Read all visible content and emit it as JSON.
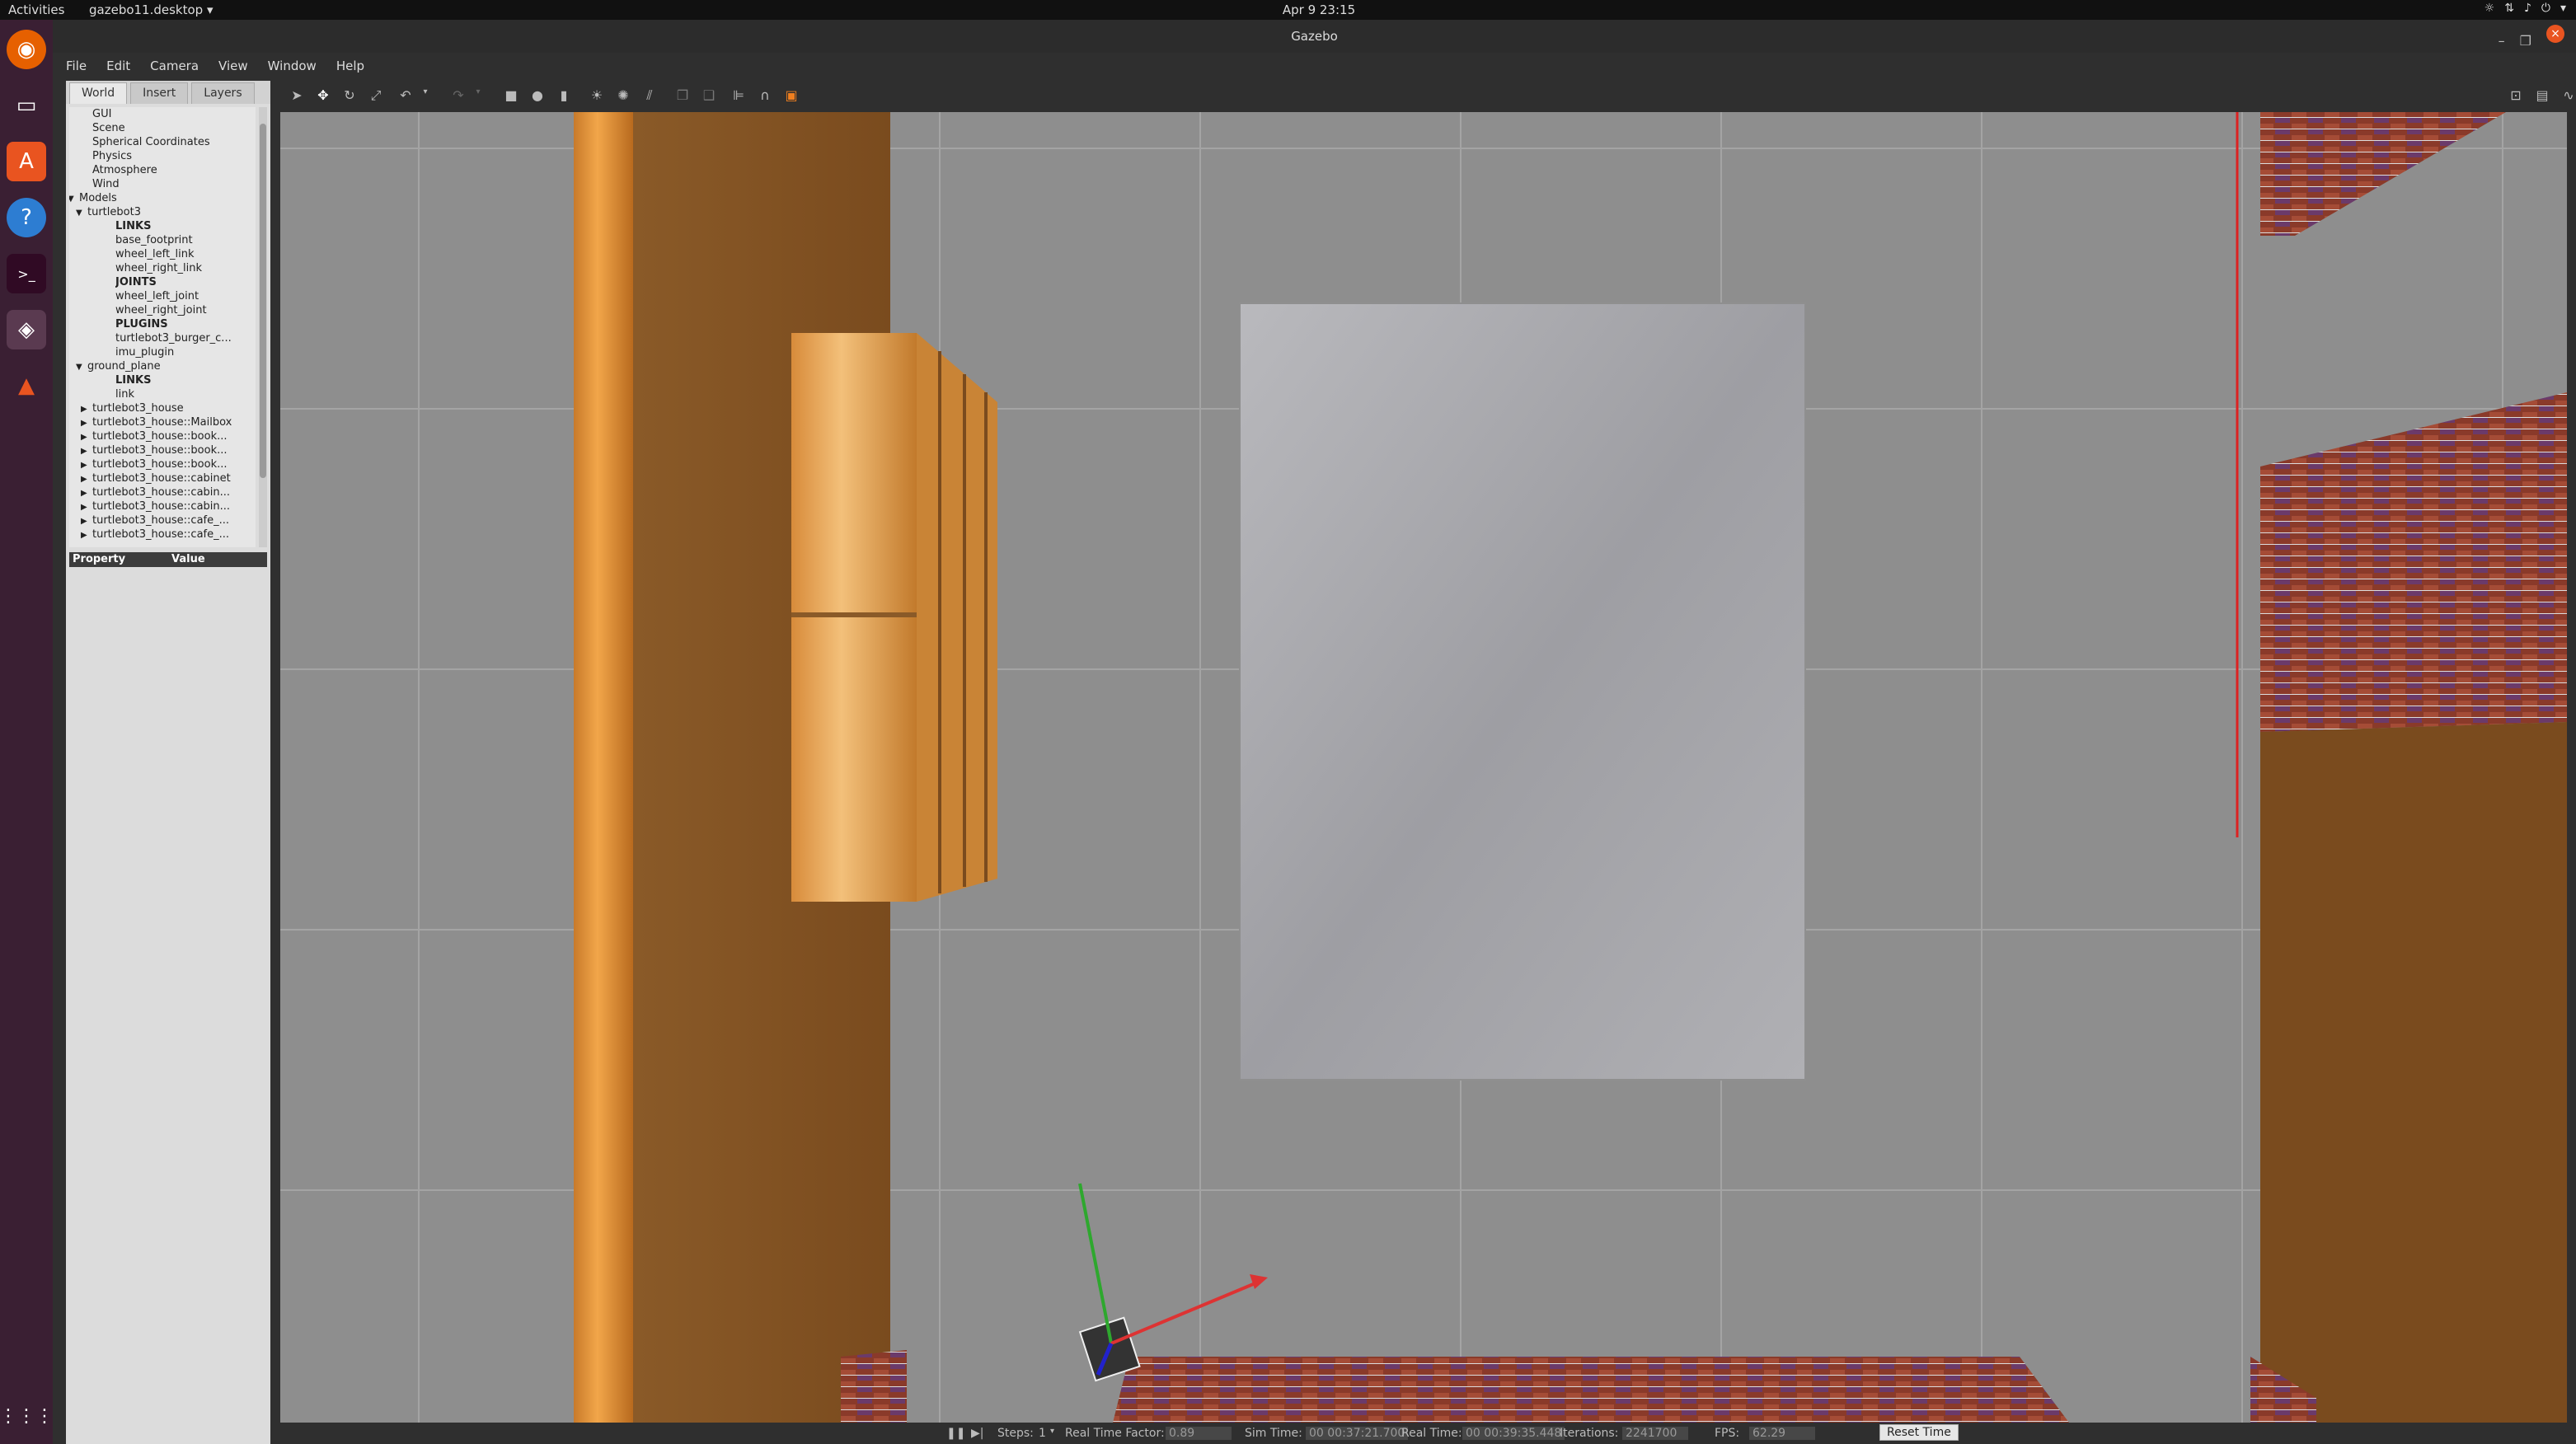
{
  "topbar": {
    "activities": "Activities",
    "app_menu": "gazebo11.desktop ▾",
    "clock": "Apr 9  23:15"
  },
  "window": {
    "title": "Gazebo"
  },
  "menu": {
    "file": "File",
    "edit": "Edit",
    "camera": "Camera",
    "view": "View",
    "window": "Window",
    "help": "Help"
  },
  "tabs": {
    "world": "World",
    "insert": "Insert",
    "layers": "Layers"
  },
  "tree": [
    "GUI",
    "Scene",
    "Spherical Coordinates",
    "Physics",
    "Atmosphere",
    "Wind",
    "Models",
    "turtlebot3",
    "LINKS",
    "base_footprint",
    "wheel_left_link",
    "wheel_right_link",
    "JOINTS",
    "wheel_left_joint",
    "wheel_right_joint",
    "PLUGINS",
    "turtlebot3_burger_c...",
    "imu_plugin",
    "ground_plane",
    "LINKS",
    "link",
    "turtlebot3_house",
    "turtlebot3_house::Mailbox",
    "turtlebot3_house::book...",
    "turtlebot3_house::book...",
    "turtlebot3_house::book...",
    "turtlebot3_house::cabinet",
    "turtlebot3_house::cabin...",
    "turtlebot3_house::cabin...",
    "turtlebot3_house::cafe_...",
    "turtlebot3_house::cafe_..."
  ],
  "props": {
    "property": "Property",
    "value": "Value"
  },
  "status": {
    "steps_label": "Steps:",
    "steps_value": "1",
    "rtf_label": "Real Time Factor:",
    "rtf_value": "0.89",
    "sim_label": "Sim Time:",
    "sim_value": "00 00:37:21.700",
    "real_label": "Real Time:",
    "real_value": "00 00:39:35.448",
    "iter_label": "Iterations:",
    "iter_value": "2241700",
    "fps_label": "FPS:",
    "fps_value": "62.29",
    "reset": "Reset Time"
  }
}
